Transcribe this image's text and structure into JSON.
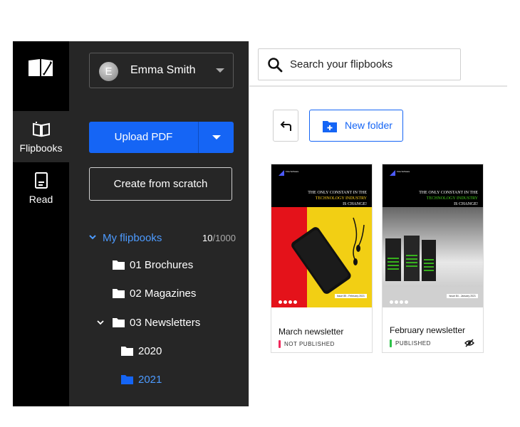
{
  "nav": {
    "items": [
      {
        "label": "Flipbooks",
        "icon": "book-open-icon",
        "active": true
      },
      {
        "label": "Read",
        "icon": "document-icon",
        "active": false
      }
    ]
  },
  "sidebar": {
    "user": {
      "initial": "E",
      "name": "Emma Smith"
    },
    "upload_label": "Upload PDF",
    "scratch_label": "Create from scratch",
    "tree": {
      "root_label": "My flipbooks",
      "count_used": "10",
      "count_total": "/1000",
      "folders": [
        {
          "label": "01 Brochures"
        },
        {
          "label": "02 Magazines"
        },
        {
          "label": "03 Newsletters",
          "expanded": true
        },
        {
          "label": "2020"
        },
        {
          "label": "2021",
          "active": true
        }
      ]
    }
  },
  "main": {
    "search": {
      "placeholder": "Search your flipbooks"
    },
    "new_folder_label": "New folder",
    "cards": [
      {
        "title": "March newsletter",
        "status": "NOT PUBLISHED",
        "status_color": "#f0295c",
        "thumb": {
          "brand": "Fiza Software",
          "headline_1": "THE ONLY CONSTANT IN THE",
          "headline_2": "TECHNOLOGY INDUSTRY",
          "headline_3": "IS CHANGE!",
          "date": "Issue 85 - February 2021"
        }
      },
      {
        "title": "February newsletter",
        "status": "PUBLISHED",
        "status_color": "#2ec24a",
        "thumb": {
          "brand": "Fiza Software",
          "headline_1": "THE ONLY CONSTANT IN THE",
          "headline_2": "TECHNOLOGY INDUSTRY",
          "headline_3": "IS CHANGE!",
          "date": "Issue 84 - January 2021"
        }
      }
    ]
  },
  "colors": {
    "accent": "#1565f5",
    "link_blue": "#4d9bff",
    "rail": "#000000",
    "sidebar": "#262626"
  }
}
